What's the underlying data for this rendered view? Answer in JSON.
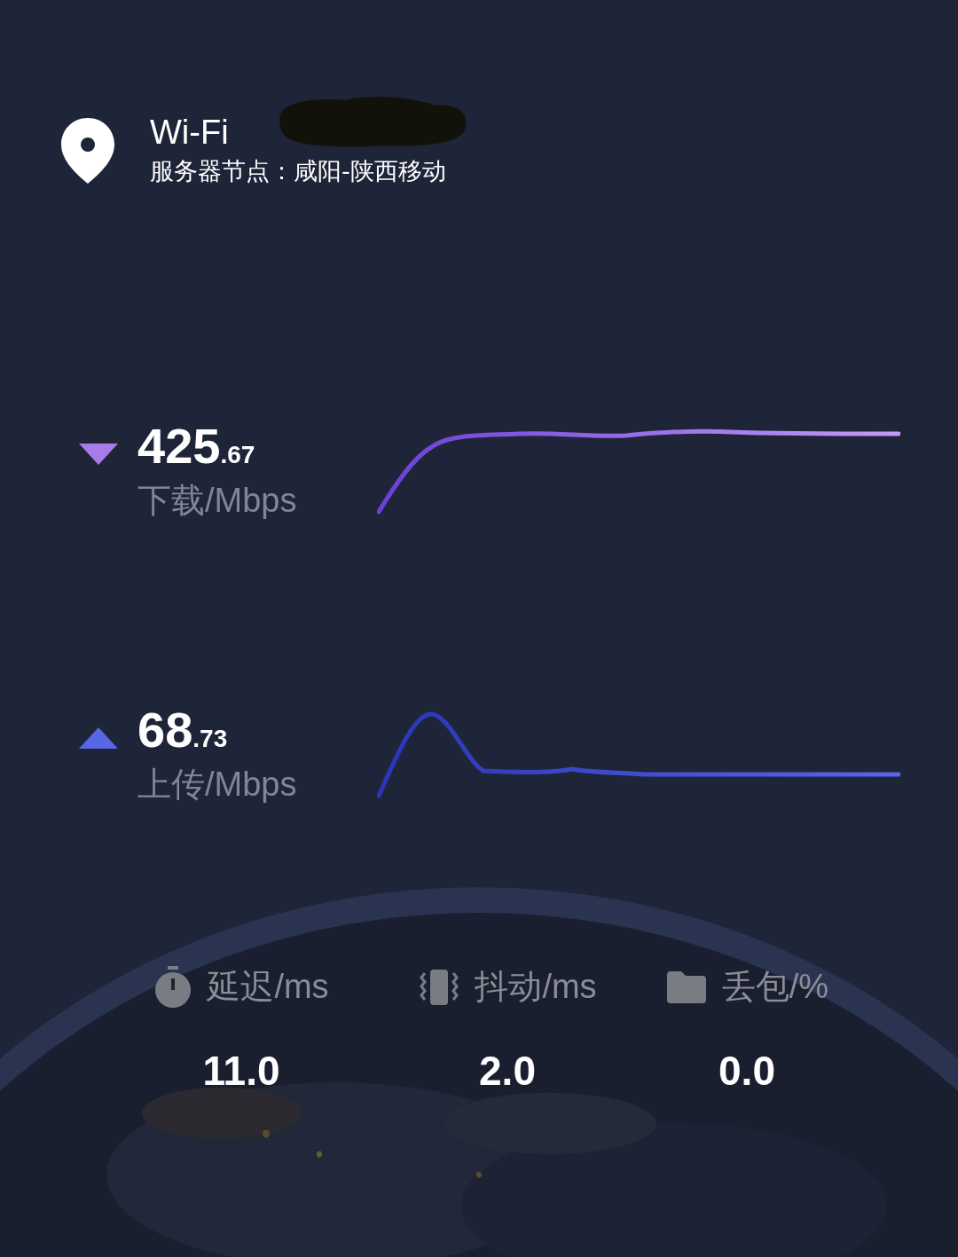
{
  "header": {
    "network": "Wi-Fi",
    "server": "服务器节点：咸阳-陕西移动"
  },
  "speeds": [
    {
      "kind": "download",
      "integer": "425",
      "fraction": ".67",
      "label": "下载/Mbps"
    },
    {
      "kind": "upload",
      "integer": "68",
      "fraction": ".73",
      "label": "上传/Mbps"
    }
  ],
  "stats": [
    {
      "kind": "latency",
      "label": "延迟/ms",
      "value": "11.0"
    },
    {
      "kind": "jitter",
      "label": "抖动/ms",
      "value": "2.0"
    },
    {
      "kind": "loss",
      "label": "丢包/%",
      "value": "0.0"
    }
  ]
}
